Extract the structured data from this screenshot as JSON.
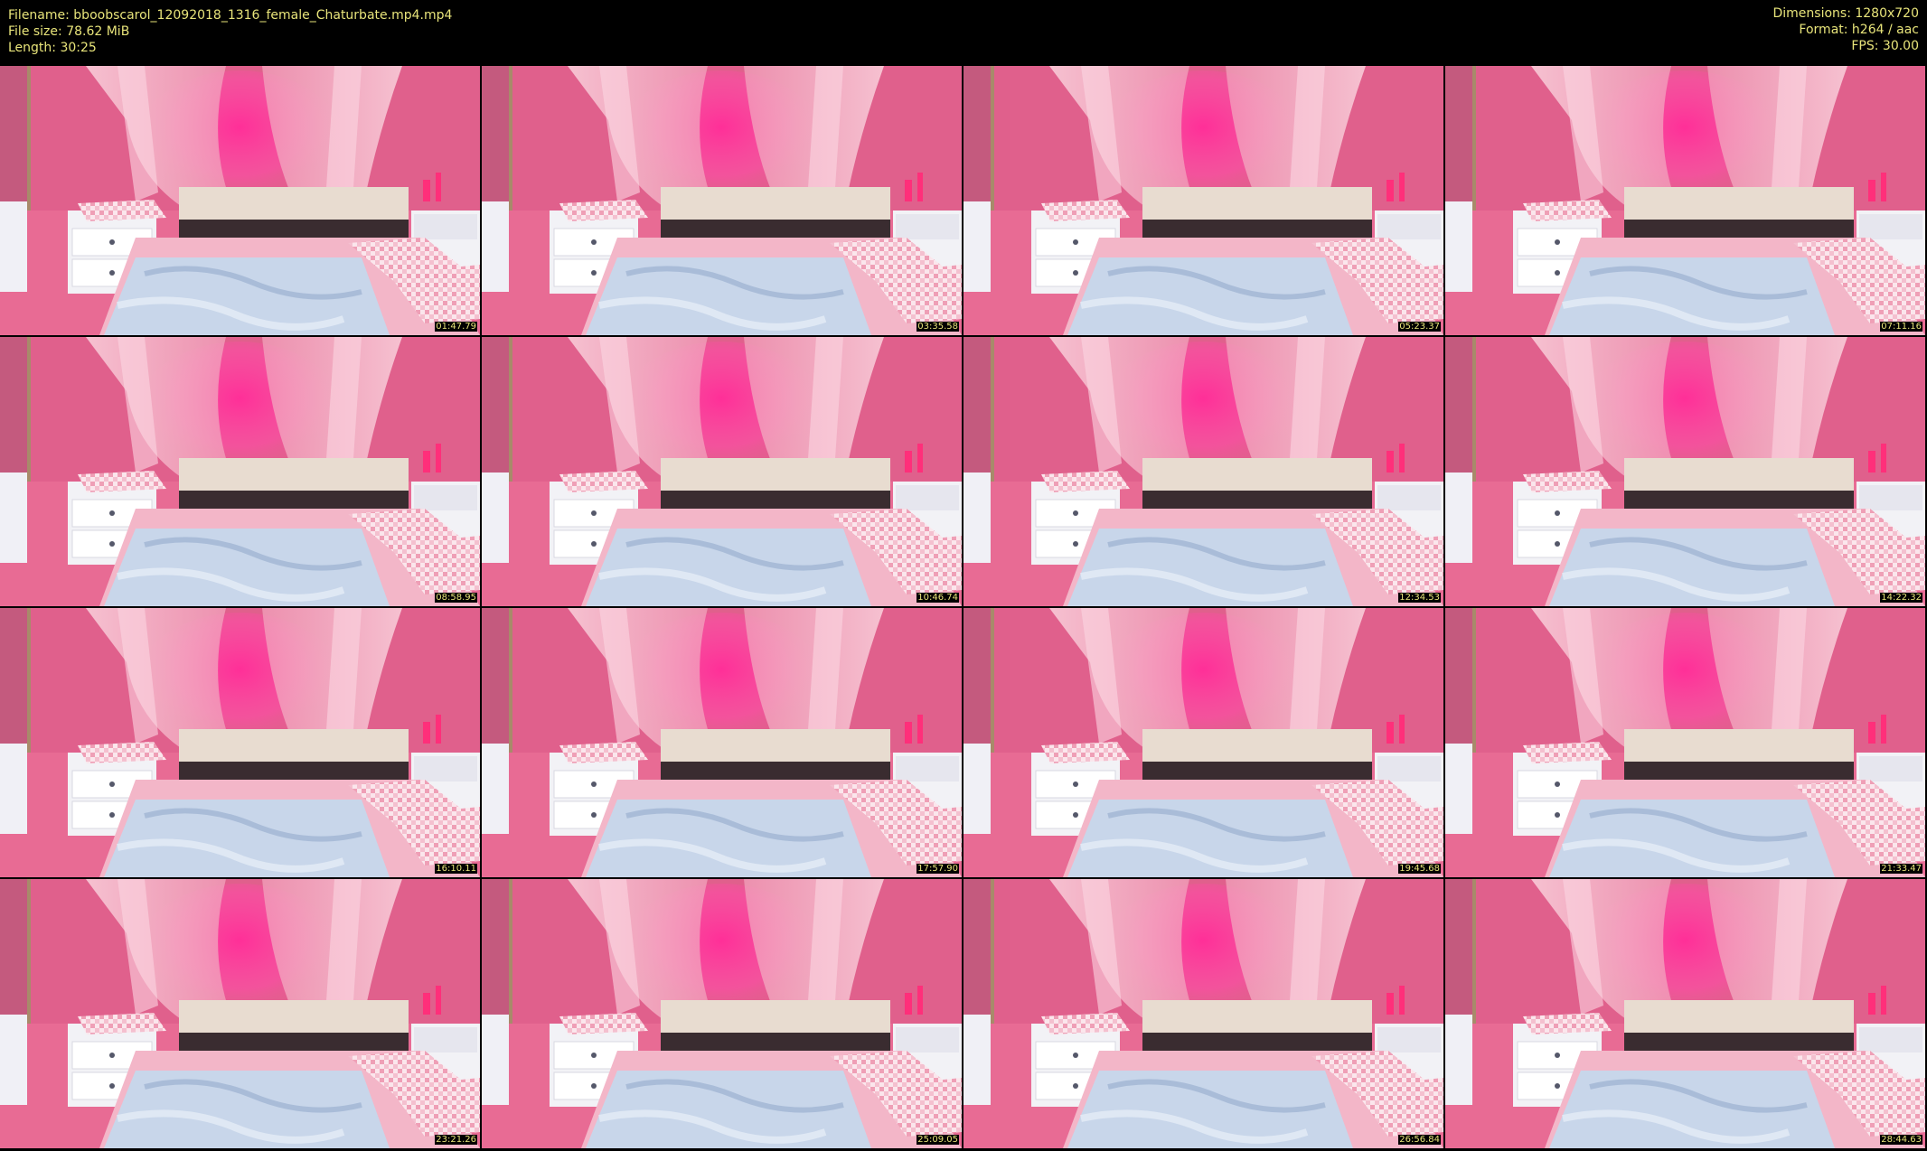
{
  "header": {
    "filename": "Filename: bboobscarol_12092018_1316_female_Chaturbate.mp4.mp4",
    "file_size": "File size: 78.62 MiB",
    "length": "Length: 30:25",
    "dimensions": "Dimensions: 1280x720",
    "format": "Format: h264 / aac",
    "fps": "FPS: 30.00"
  },
  "thumbnails": [
    {
      "timestamp": "01:47.79"
    },
    {
      "timestamp": "03:35.58"
    },
    {
      "timestamp": "05:23.37"
    },
    {
      "timestamp": "07:11.16"
    },
    {
      "timestamp": "08:58.95"
    },
    {
      "timestamp": "10:46.74"
    },
    {
      "timestamp": "12:34.53"
    },
    {
      "timestamp": "14:22.32"
    },
    {
      "timestamp": "16:10.11"
    },
    {
      "timestamp": "17:57.90"
    },
    {
      "timestamp": "19:45.68"
    },
    {
      "timestamp": "21:33.47"
    },
    {
      "timestamp": "23:21.26"
    },
    {
      "timestamp": "25:09.05"
    },
    {
      "timestamp": "26:56.84"
    },
    {
      "timestamp": "28:44.63"
    }
  ],
  "colors": {
    "header_text": "#e8e47a",
    "background": "#000000",
    "wall": "#e0608c",
    "curtain": "#f4b8cc",
    "glow": "#ff3fa0",
    "headboard": "#e8dcd0",
    "headboard_base": "#3a2c30",
    "nightstand": "#f2f2f6",
    "sheet": "#c8d6ea",
    "pillow": "#f4c4d2"
  }
}
